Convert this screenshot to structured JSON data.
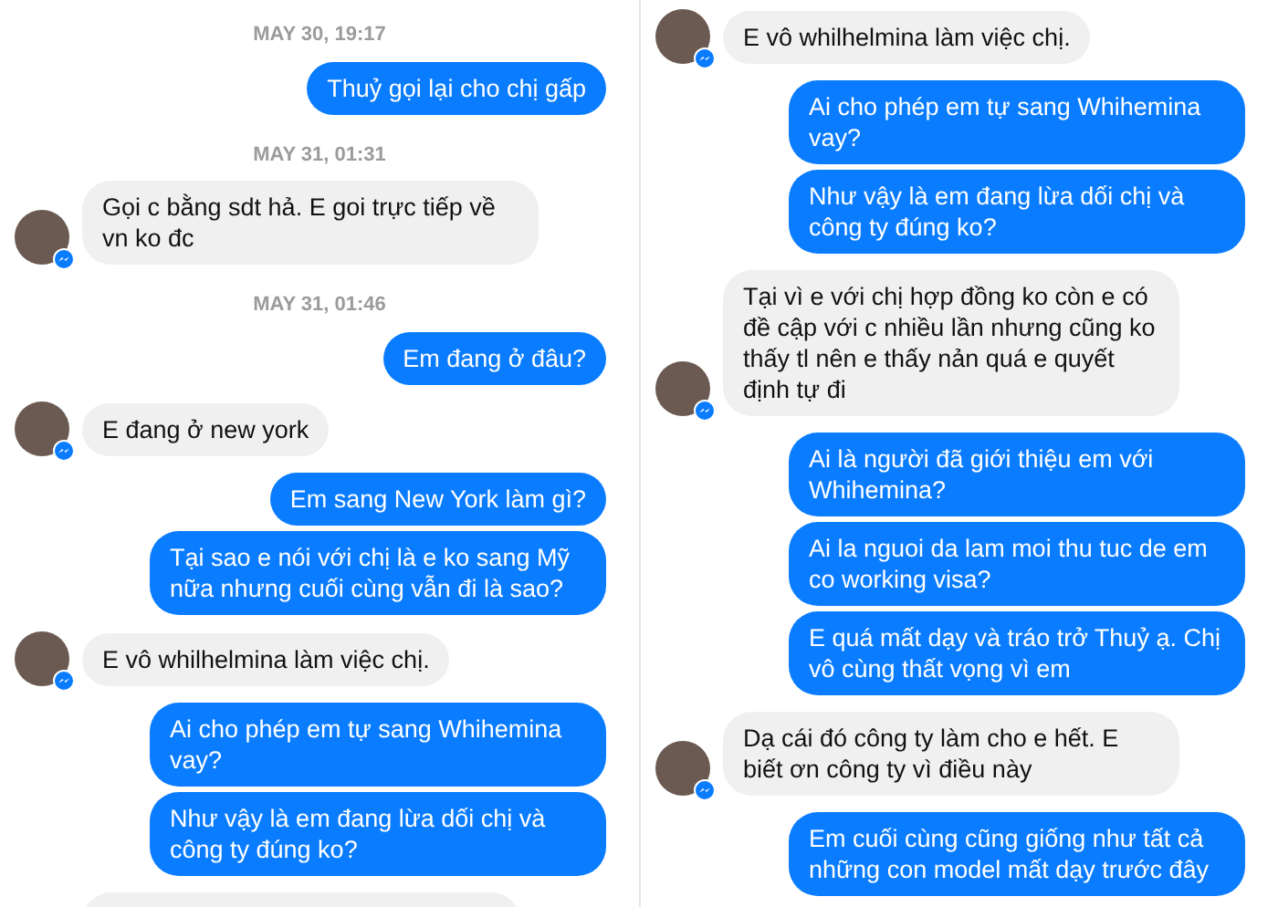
{
  "panels": [
    {
      "items": [
        {
          "kind": "time",
          "text": "MAY 30, 19:17"
        },
        {
          "kind": "outgoing",
          "text": "Thuỷ gọi lại cho chị gấp"
        },
        {
          "kind": "time",
          "text": "MAY 31, 01:31"
        },
        {
          "kind": "incoming",
          "text": "Gọi c bằng sdt hả. E goi trực tiếp về vn ko đc"
        },
        {
          "kind": "time",
          "text": "MAY 31, 01:46"
        },
        {
          "kind": "outgoing",
          "text": "Em đang ở đâu?"
        },
        {
          "kind": "incoming",
          "text": "E đang ở new york"
        },
        {
          "kind": "outgoing",
          "text": "Em sang New York làm gì?"
        },
        {
          "kind": "outgoing",
          "text": "Tại sao e nói với chị là e ko sang Mỹ nữa nhưng cuối cùng vẫn đi là sao?"
        },
        {
          "kind": "incoming",
          "text": "E vô whilhelmina làm việc chị."
        },
        {
          "kind": "outgoing",
          "text": "Ai cho phép em tự sang Whihemina vay?"
        },
        {
          "kind": "outgoing",
          "text": "Như vậy là em đang lừa dối chị và công ty đúng ko?"
        },
        {
          "kind": "incoming_cut"
        }
      ]
    },
    {
      "items": [
        {
          "kind": "incoming",
          "text": "E vô whilhelmina làm việc chị."
        },
        {
          "kind": "outgoing",
          "text": "Ai cho phép em tự sang Whihemina vay?"
        },
        {
          "kind": "outgoing",
          "text": "Như vậy là em đang lừa dối chị và công ty đúng ko?"
        },
        {
          "kind": "incoming",
          "text": "Tại vì e với chị hợp đồng ko còn e có đề cập với c nhiều lần nhưng cũng ko thấy tl nên e thấy nản quá e quyết định tự đi"
        },
        {
          "kind": "outgoing",
          "text": "Ai là người đã giới thiệu em với Whihemina?"
        },
        {
          "kind": "outgoing",
          "text": "Ai la nguoi da lam moi thu tuc de em co working visa?"
        },
        {
          "kind": "outgoing",
          "text": "E quá mất dạy và tráo trở Thuỷ ạ. Chị vô cùng thất vọng vì em"
        },
        {
          "kind": "incoming",
          "text": "Dạ cái đó công ty làm cho e hết. E biết ơn công ty vì điều này"
        },
        {
          "kind": "outgoing",
          "text": "Em cuối cùng cũng giống như tất cả những con model mất dạy trước đây"
        }
      ]
    }
  ]
}
